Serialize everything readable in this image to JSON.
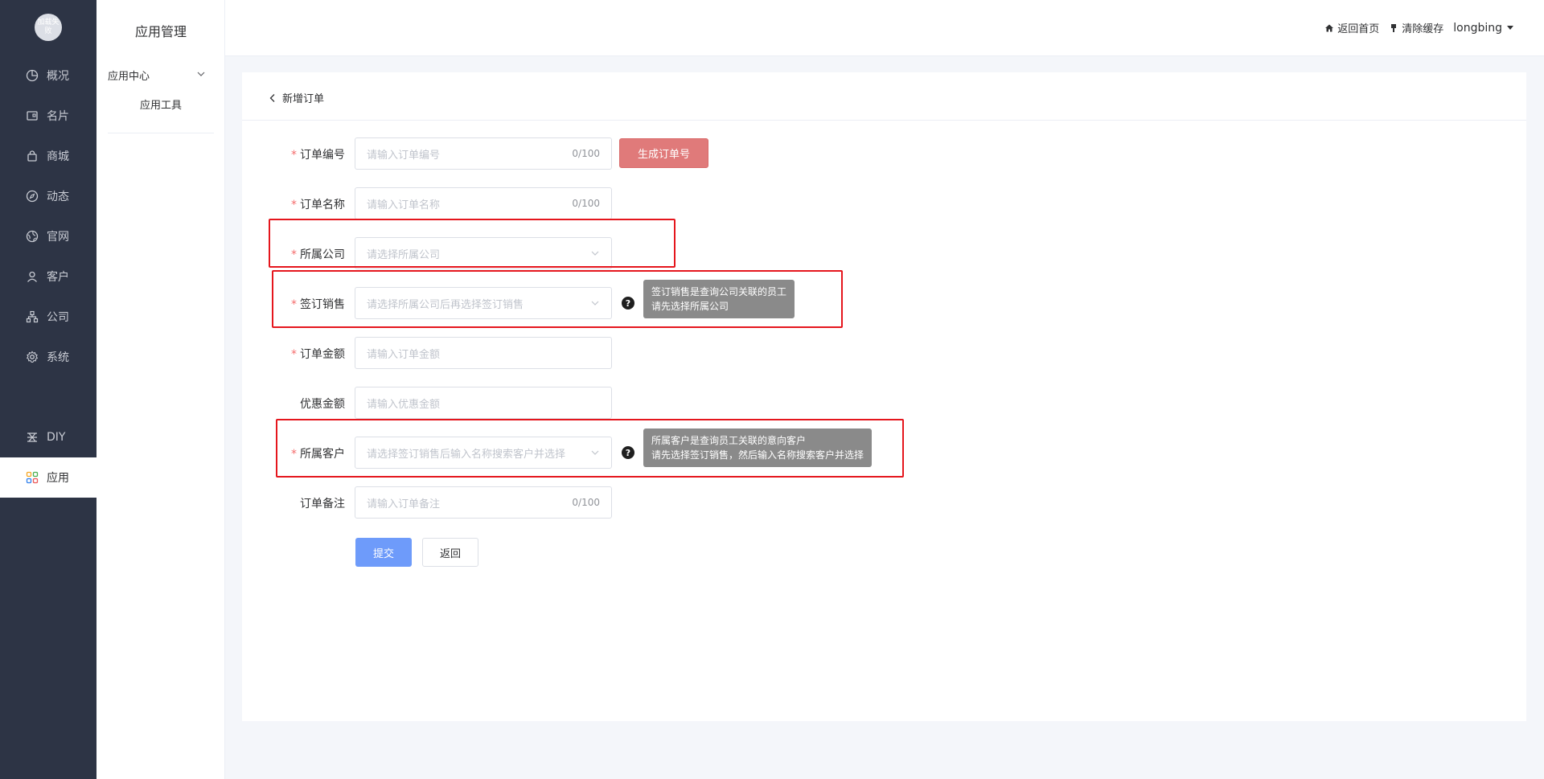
{
  "nav": {
    "logo_text": "加载失败",
    "items": [
      {
        "label": "概况",
        "icon": "pie-chart-icon"
      },
      {
        "label": "名片",
        "icon": "card-icon"
      },
      {
        "label": "商城",
        "icon": "shop-bag-icon"
      },
      {
        "label": "动态",
        "icon": "compass-icon"
      },
      {
        "label": "官网",
        "icon": "globe-icon"
      },
      {
        "label": "客户",
        "icon": "user-icon"
      },
      {
        "label": "公司",
        "icon": "org-chart-icon"
      },
      {
        "label": "系统",
        "icon": "gear-icon"
      },
      {
        "label": "DIY",
        "icon": "diy-icon"
      },
      {
        "label": "应用",
        "icon": "apps-grid-icon",
        "active": true
      }
    ]
  },
  "submenu": {
    "title": "应用管理",
    "group": "应用中心",
    "child": "应用工具"
  },
  "header": {
    "home_label": "返回首页",
    "clear_cache_label": "清除缓存",
    "username": "longbing"
  },
  "page": {
    "back_title": "新增订单"
  },
  "form": {
    "order_no": {
      "label": "订单编号",
      "placeholder": "请输入订单编号",
      "count": "0/100",
      "required": true
    },
    "generate_button": "生成订单号",
    "order_name": {
      "label": "订单名称",
      "placeholder": "请输入订单名称",
      "count": "0/100",
      "required": true
    },
    "company": {
      "label": "所属公司",
      "placeholder": "请选择所属公司",
      "required": true
    },
    "sales": {
      "label": "签订销售",
      "placeholder": "请选择所属公司后再选择签订销售",
      "required": true,
      "tip_line1": "签订销售是查询公司关联的员工",
      "tip_line2": "请先选择所属公司"
    },
    "amount": {
      "label": "订单金额",
      "placeholder": "请输入订单金额",
      "required": true
    },
    "discount": {
      "label": "优惠金额",
      "placeholder": "请输入优惠金额",
      "required": false
    },
    "customer": {
      "label": "所属客户",
      "placeholder": "请选择签订销售后输入名称搜索客户并选择",
      "required": true,
      "tip_line1": "所属客户是查询员工关联的意向客户",
      "tip_line2": "请先选择签订销售，然后输入名称搜索客户并选择"
    },
    "remark": {
      "label": "订单备注",
      "placeholder": "请输入订单备注",
      "count": "0/100",
      "required": false
    },
    "submit_button": "提交",
    "back_button": "返回"
  },
  "colors": {
    "nav_bg": "#2d3445",
    "primary": "#6e9bfa",
    "danger_button": "#e07a7a",
    "highlight": "#e5161d"
  }
}
